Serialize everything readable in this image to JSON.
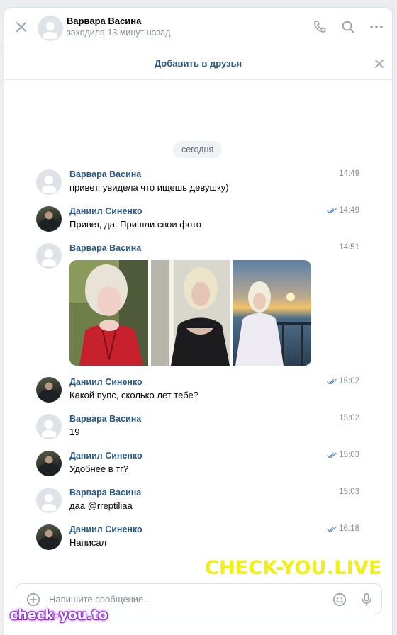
{
  "header": {
    "name": "Варвара Васина",
    "status": "заходила 13 минут назад"
  },
  "add_friend": {
    "label": "Добавить в друзья"
  },
  "date_separator": "сегодня",
  "colors": {
    "link": "#2a5885",
    "read_check": "#4986cc",
    "watermark_yellow": "#f2ef16",
    "watermark_purple": "#9b35d8"
  },
  "messages": [
    {
      "author": "Варвара Васина",
      "avatar": "default",
      "time": "14:49",
      "text": "привет, увидела что ищешь девушку)",
      "read": false
    },
    {
      "author": "Даниил Синенко",
      "avatar": "photo",
      "time": "14:49",
      "text": "Привет, да. Пришли свои фото",
      "read": true
    },
    {
      "author": "Варвара Васина",
      "avatar": "default",
      "time": "14:51",
      "text": "",
      "read": false,
      "photos": 3
    },
    {
      "author": "Даниил Синенко",
      "avatar": "photo",
      "time": "15:02",
      "text": "Какой пупс, сколько лет тебе?",
      "read": true
    },
    {
      "author": "Варвара Васина",
      "avatar": "default",
      "time": "15:02",
      "text": "19",
      "read": false
    },
    {
      "author": "Даниил Синенко",
      "avatar": "photo",
      "time": "15:03",
      "text": "Удобнее в тг?",
      "read": true
    },
    {
      "author": "Варвара Васина",
      "avatar": "default",
      "time": "15:03",
      "text": "даа @rreptiliaa",
      "read": false
    },
    {
      "author": "Даниил Синенко",
      "avatar": "photo",
      "time": "16:18",
      "text": "Написал",
      "read": true
    }
  ],
  "composer": {
    "placeholder": "Напишите сообщение..."
  },
  "watermarks": {
    "top": "CHECK-YOU.LIVE",
    "bottom": "check-you.to"
  }
}
